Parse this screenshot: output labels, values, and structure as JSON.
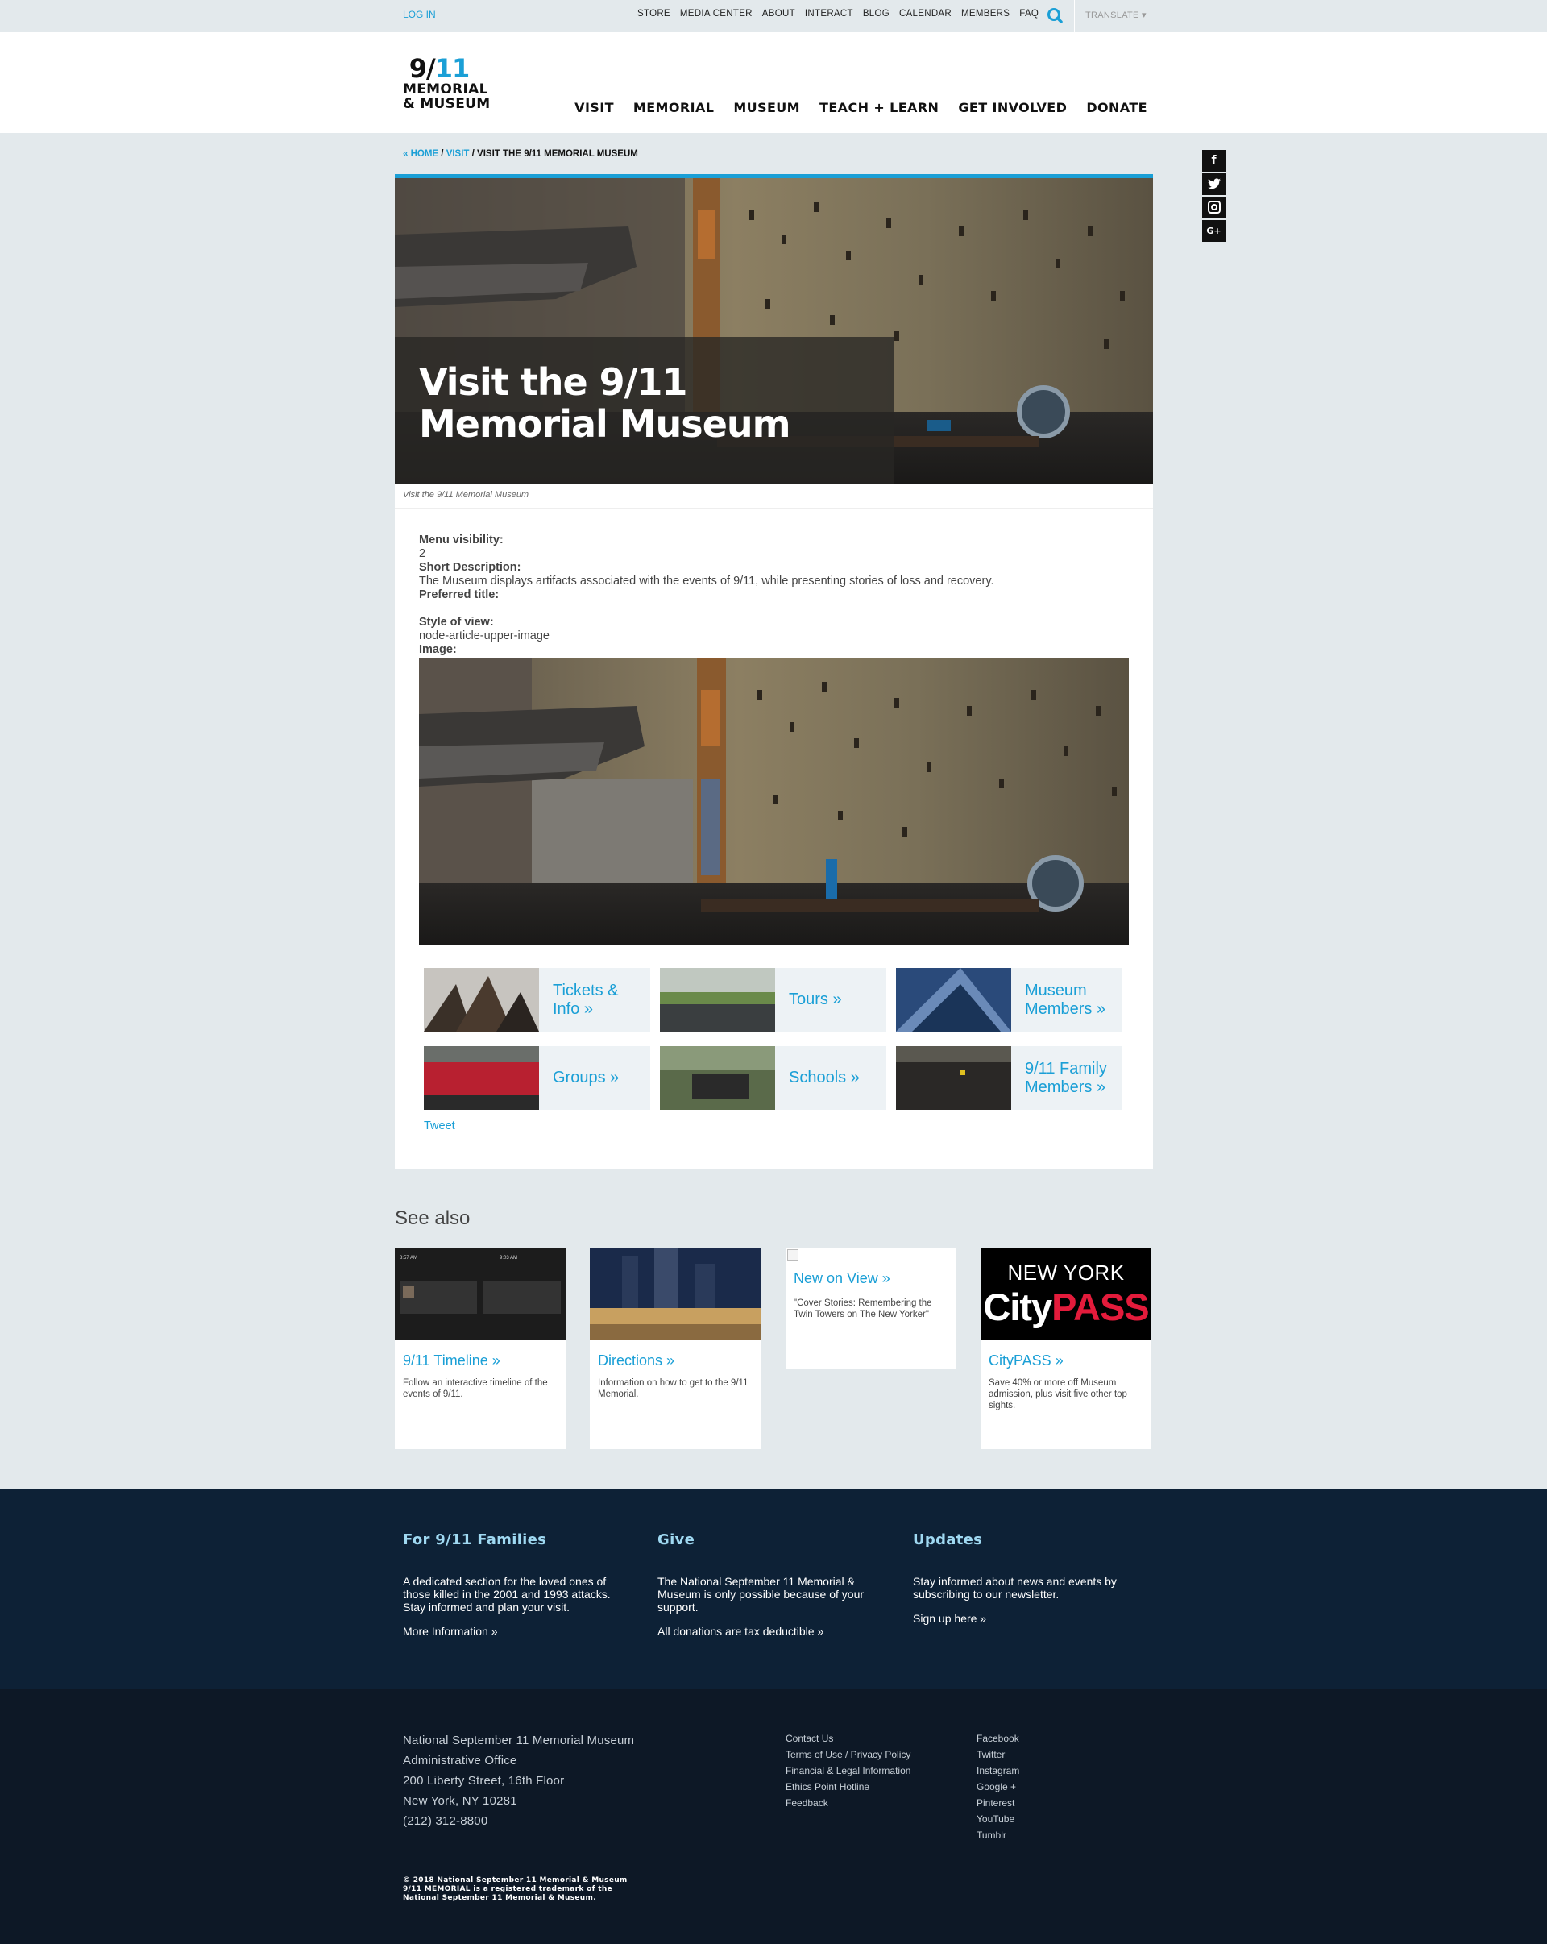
{
  "topbar": {
    "login": "LOG IN",
    "util_nav": [
      "STORE",
      "MEDIA CENTER",
      "ABOUT",
      "INTERACT",
      "BLOG",
      "CALENDAR",
      "MEMBERS",
      "FAQ"
    ],
    "translate": "TRANSLATE ▾"
  },
  "logo": {
    "line1a": "9/",
    "line1b": "11",
    "line2": "MEMORIAL",
    "line3": "& MUSEUM"
  },
  "main_nav": [
    "VISIT",
    "MEMORIAL",
    "MUSEUM",
    "TEACH + LEARN",
    "GET INVOLVED",
    "DONATE"
  ],
  "breadcrumb": {
    "home": "« HOME",
    "sep1": " / ",
    "visit": "VISIT",
    "sep2": " / ",
    "current": "VISIT THE 9/11 MEMORIAL MUSEUM"
  },
  "social": [
    "f",
    "t",
    "ig",
    "G+"
  ],
  "hero": {
    "title": "Visit the 9/11 Memorial Museum",
    "caption": "Visit the 9/11 Memorial Museum"
  },
  "fields": {
    "menu_visibility_label": "Menu visibility:",
    "menu_visibility_value": "2",
    "short_desc_label": "Short Description:",
    "short_desc_value": "The Museum displays artifacts associated with the events of 9/11, while presenting stories of loss and recovery.",
    "preferred_title_label": "Preferred title:",
    "style_label": "Style of view:",
    "style_value": "node-article-upper-image",
    "image_label": "Image:"
  },
  "tiles": [
    {
      "label": "Tickets & Info »"
    },
    {
      "label": "Tours »"
    },
    {
      "label": "Museum Members »"
    },
    {
      "label": "Groups »"
    },
    {
      "label": "Schools »"
    },
    {
      "label": "9/11 Family Members »"
    }
  ],
  "tweet": "Tweet",
  "see_also": {
    "heading": "See also",
    "cards": [
      {
        "title": "9/11 Timeline »",
        "desc": "Follow an interactive timeline of the events of 9/11."
      },
      {
        "title": "Directions »",
        "desc": "Information on how to get to the 9/11 Memorial."
      },
      {
        "title": "New on View »",
        "desc": "\"Cover Stories: Remembering the Twin Towers on The New Yorker\""
      },
      {
        "title": "CityPASS »",
        "desc": "Save 40% or more off Museum admission, plus visit five other top sights."
      }
    ],
    "citypass_logo": {
      "top": "NEW YORK",
      "city": "City",
      "pass": "PASS"
    },
    "timeline_thumb": {
      "t1": "8:57 AM",
      "t2": "9:03 AM"
    }
  },
  "footer_top": [
    {
      "heading": "For 9/11 Families",
      "text": "A dedicated section for the loved ones of those killed in the 2001 and 1993 attacks. Stay informed and plan your visit.",
      "link": "More Information »"
    },
    {
      "heading": "Give",
      "text": "The National September 11 Memorial & Museum is only possible because of your support.",
      "link": "All donations are tax deductible »"
    },
    {
      "heading": "Updates",
      "text": "Stay informed about news and events by subscribing to our newsletter.",
      "link": "Sign up here »"
    }
  ],
  "address": [
    "National September 11 Memorial Museum",
    "Administrative Office",
    "200 Liberty Street, 16th Floor",
    "New York, NY 10281",
    "(212) 312-8800"
  ],
  "footer_links_1": [
    "Contact Us",
    "Terms of Use / Privacy Policy",
    "Financial & Legal Information",
    "Ethics Point Hotline",
    "Feedback"
  ],
  "footer_links_2": [
    "Facebook",
    "Twitter",
    "Instagram",
    "Google +",
    "Pinterest",
    "YouTube",
    "Tumblr"
  ],
  "copyright": [
    "© 2018 National September 11 Memorial & Museum",
    "9/11 MEMORIAL is a registered trademark of the",
    "National September 11 Memorial & Museum."
  ],
  "colors": {
    "accent": "#1a9fd6",
    "page_bg": "#e3e9ec",
    "footer_top": "#0d2136",
    "footer_bottom": "#0d1826",
    "citypass_red": "#e31b3b"
  }
}
